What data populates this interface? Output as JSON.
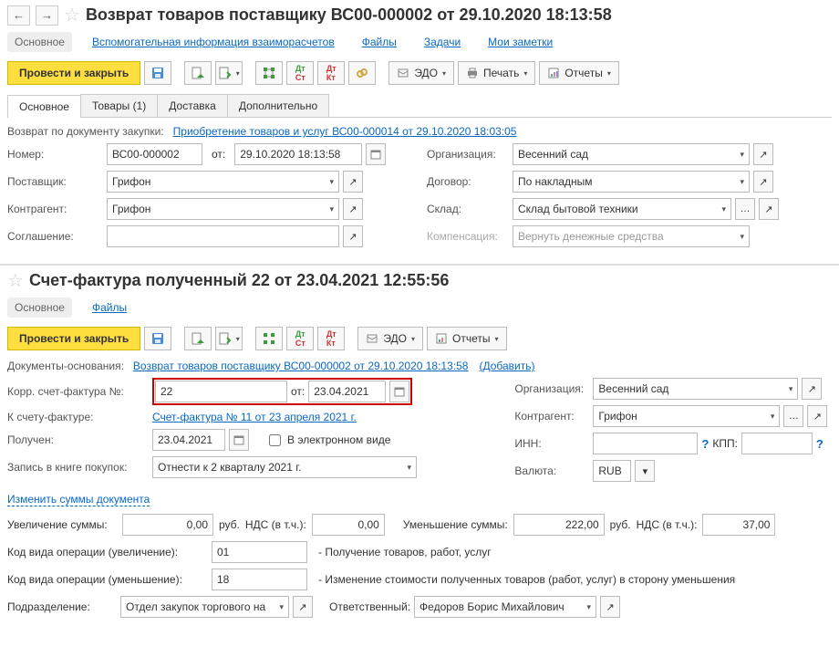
{
  "doc1": {
    "title": "Возврат товаров поставщику ВС00-000002 от 29.10.2020 18:13:58",
    "subnav": {
      "main": "Основное",
      "aux": "Вспомогательная информация взаиморасчетов",
      "files": "Файлы",
      "tasks": "Задачи",
      "notes": "Мои заметки"
    },
    "toolbar": {
      "submit_close": "Провести и закрыть",
      "edo": "ЭДО",
      "print": "Печать",
      "reports": "Отчеты"
    },
    "formtabs": {
      "main": "Основное",
      "goods": "Товары (1)",
      "delivery": "Доставка",
      "extra": "Дополнительно"
    },
    "return_label": "Возврат по документу закупки:",
    "return_link": "Приобретение товаров и услуг ВС00-000014 от 29.10.2020 18:03:05",
    "fields": {
      "number_label": "Номер:",
      "number_val": "ВС00-000002",
      "from_label": "от:",
      "date_val": "29.10.2020 18:13:58",
      "supplier_label": "Поставщик:",
      "supplier_val": "Грифон",
      "counterparty_label": "Контрагент:",
      "counterparty_val": "Грифон",
      "agreement_label": "Соглашение:",
      "agreement_val": "",
      "org_label": "Организация:",
      "org_val": "Весенний сад",
      "contract_label": "Договор:",
      "contract_val": "По накладным",
      "warehouse_label": "Склад:",
      "warehouse_val": "Склад бытовой техники",
      "compensation_label": "Компенсация:",
      "compensation_val": "Вернуть денежные средства"
    }
  },
  "doc2": {
    "title": "Счет-фактура полученный 22 от 23.04.2021 12:55:56",
    "subnav": {
      "main": "Основное",
      "files": "Файлы"
    },
    "toolbar": {
      "submit_close": "Провести и закрыть",
      "edo": "ЭДО",
      "reports": "Отчеты"
    },
    "basis_label": "Документы-основания:",
    "basis_link": "Возврат товаров поставщику ВС00-000002 от 29.10.2020 18:13:58",
    "basis_add": "(Добавить)",
    "left": {
      "corr_label": "Корр. счет-фактура №:",
      "corr_num": "22",
      "corr_from": "от:",
      "corr_date": "23.04.2021",
      "to_invoice_label": "К счету-фактуре:",
      "to_invoice_link": "Счет-фактура № 11 от 23 апреля 2021 г.",
      "received_label": "Получен:",
      "received_date": "23.04.2021",
      "electronic": "В электронном виде",
      "book_label": "Запись в книге покупок:",
      "book_val": "Отнести к 2 кварталу 2021 г."
    },
    "right": {
      "org_label": "Организация:",
      "org_val": "Весенний сад",
      "counterparty_label": "Контрагент:",
      "counterparty_val": "Грифон",
      "inn_label": "ИНН:",
      "inn_val": "",
      "kpp_label": "КПП:",
      "kpp_val": "",
      "currency_label": "Валюта:",
      "currency_val": "RUB"
    },
    "change_sums": "Изменить суммы документа",
    "sums": {
      "increase_label": "Увеличение суммы:",
      "increase_val": "0,00",
      "rub": "руб.",
      "vat_label": "НДС (в т.ч.):",
      "increase_vat": "0,00",
      "decrease_label": "Уменьшение суммы:",
      "decrease_val": "222,00",
      "decrease_vat": "37,00"
    },
    "opcode_inc_label": "Код вида операции (увеличение):",
    "opcode_inc": "01",
    "opcode_inc_desc": "- Получение товаров, работ, услуг",
    "opcode_dec_label": "Код вида операции (уменьшение):",
    "opcode_dec": "18",
    "opcode_dec_desc": "- Изменение стоимости полученных товаров (работ, услуг) в сторону уменьшения",
    "dept_label": "Подразделение:",
    "dept_val": "Отдел закупок торгового на",
    "resp_label": "Ответственный:",
    "resp_val": "Федоров Борис Михайлович"
  }
}
